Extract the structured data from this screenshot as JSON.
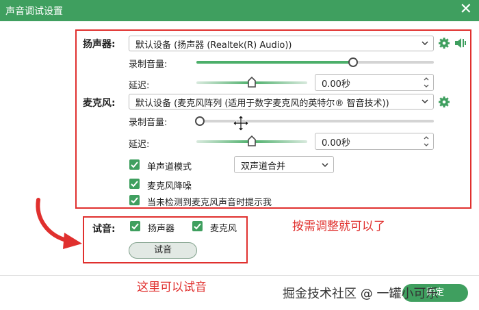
{
  "window": {
    "title": "声音调试设置",
    "close_glyph": "✕"
  },
  "speaker": {
    "label": "扬声器:",
    "device": "默认设备 (扬声器 (Realtek(R) Audio))",
    "volume_label": "录制音量:",
    "volume_level": 0.66,
    "delay_label": "延迟:",
    "delay_level": 0.5,
    "delay_value": "0.00秒",
    "icons": [
      "gear-icon",
      "speaker-volume-icon"
    ]
  },
  "mic": {
    "label": "麦克风:",
    "device": "默认设备 (麦克风阵列 (适用于数字麦克风的英特尔® 智音技术))",
    "volume_label": "录制音量:",
    "volume_level": 0.0,
    "delay_label": "延迟:",
    "delay_level": 0.5,
    "delay_value": "0.00秒",
    "icons": [
      "gear-icon"
    ]
  },
  "options": {
    "mono_label": "单声道模式",
    "mono_checked": true,
    "mono_select": "双声道合并",
    "noise_label": "麦克风降噪",
    "noise_checked": true,
    "prompt_label": "当未检测到麦克风声音时提示我",
    "prompt_checked": true
  },
  "test": {
    "label": "试音:",
    "speaker_label": "扬声器",
    "speaker_checked": true,
    "mic_label": "麦克风",
    "mic_checked": true,
    "button_label": "试音"
  },
  "annotations": {
    "adjust": "按需调整就可以了",
    "test_here": "这里可以试音"
  },
  "footer": {
    "watermark": "掘金技术社区 @ 一罐小可乐",
    "ok_label": "确定"
  },
  "colors": {
    "accent": "#3f9f5f",
    "annotation": "#e0302e"
  }
}
